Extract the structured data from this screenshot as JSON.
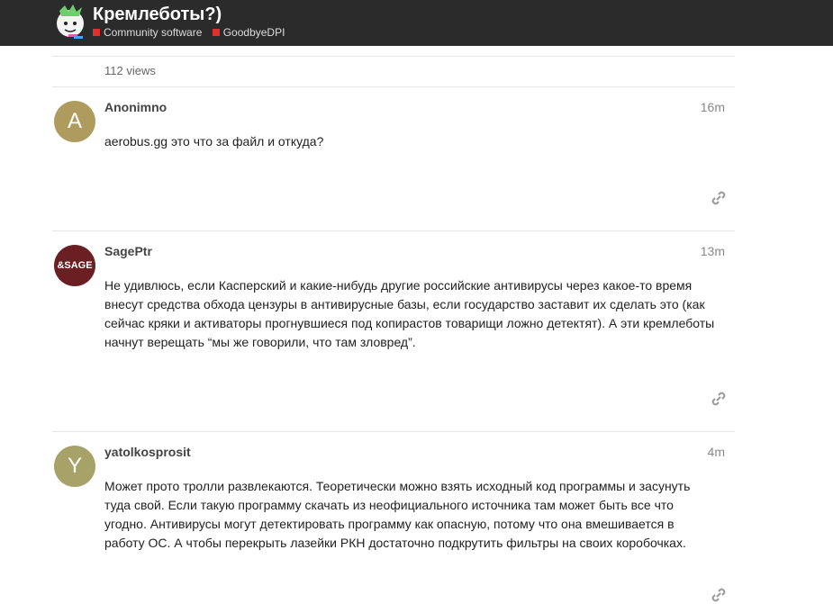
{
  "header": {
    "title": "Кремлеботы?)",
    "categories": [
      {
        "label": "Community software",
        "color": "#e02f2f"
      },
      {
        "label": "GoodbyeDPI",
        "color": "#e02f2f"
      }
    ]
  },
  "topic": {
    "views": "112 views"
  },
  "posts": [
    {
      "username": "Anonimno",
      "avatar_text": "A",
      "avatar_color": "#b09b5e",
      "time": "16m",
      "body": "aerobus.gg это что за файл и откуда?"
    },
    {
      "username": "SagePtr",
      "avatar_text": "&SAGE",
      "avatar_color": "#6b1f23",
      "time": "13m",
      "body": "Не удивлюсь, если Касперский и какие-нибудь другие российские антивирусы через какое-то время внесут средства обхода цензуры в антивирусные базы, если государство заставит их сделать это (как сейчас кряки и активаторы прогнувшиеся под копирастов товарищи ложно детектят). А эти кремлеботы начнут верещать “мы же говорили, что там зловред”."
    },
    {
      "username": "yatolkosprosit",
      "avatar_text": "Y",
      "avatar_color": "#a7a268",
      "time": "4m",
      "body": "Может прото тролли развлекаются. Теоретически можно взять исходный код программы и засунуть туда свой. Если такую программу скачать из неофициального источника там может быть все что угодно. Антивирусы могут детектировать программу как опасную, потому что она вмешивается в работу ОС. А чтобы перекрыть лазейки РКН достаточно подкрутить фильтры на своих коробочках."
    }
  ]
}
